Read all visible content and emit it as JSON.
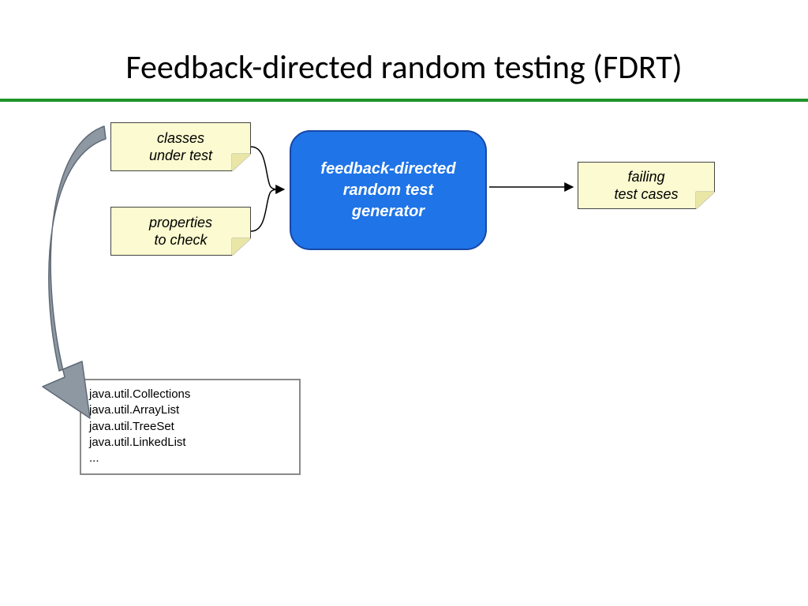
{
  "title": "Feedback-directed random testing (FDRT)",
  "notes": {
    "classes": "classes\nunder test",
    "properties": "properties\nto check",
    "failing": "failing\ntest cases"
  },
  "processor": "feedback-directed\nrandom test\ngenerator",
  "codebox": "java.util.Collections\njava.util.ArrayList\njava.util.TreeSet\njava.util.LinkedList\n...",
  "colors": {
    "rule": "#1f932c",
    "note_bg": "#fbfad0",
    "processor_bg": "#1f74e7",
    "processor_border": "#1648a8",
    "big_arrow": "#8e98a3"
  }
}
